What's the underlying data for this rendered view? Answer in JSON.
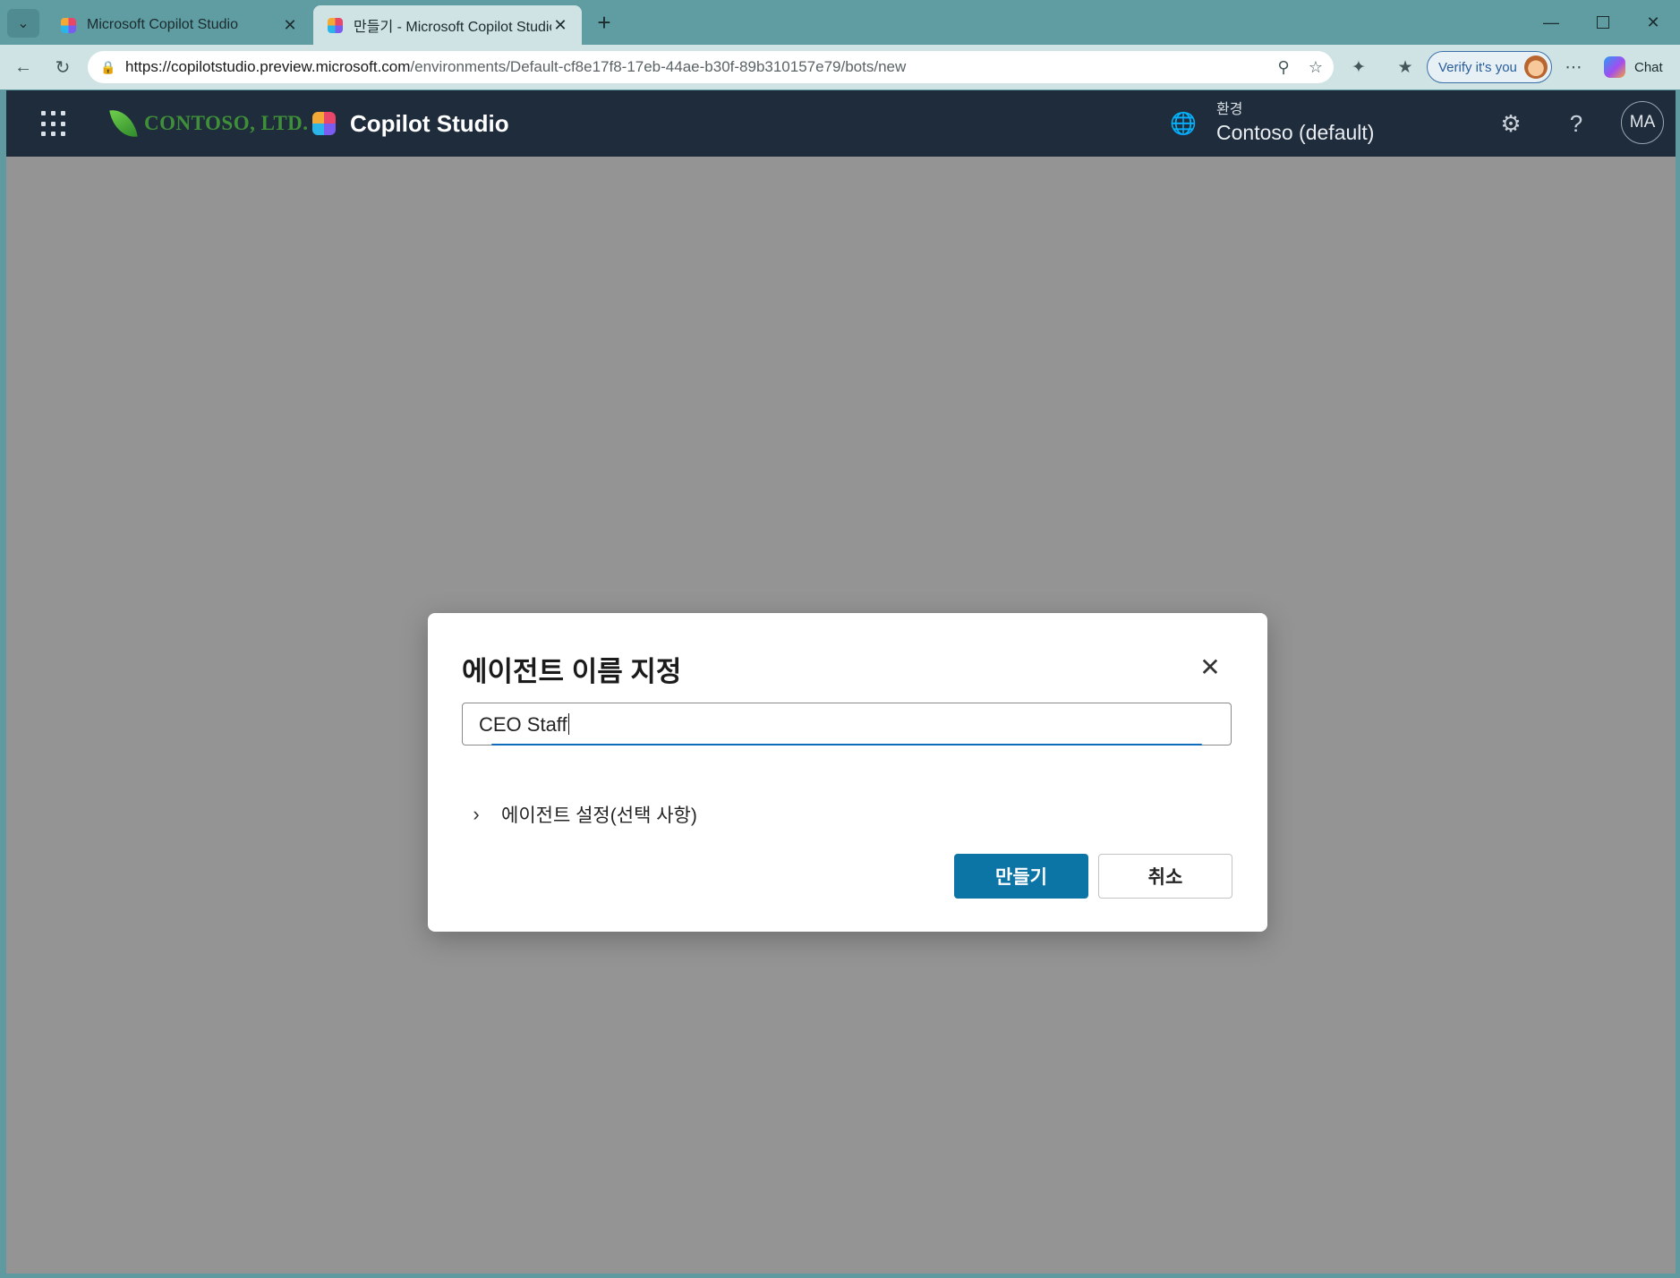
{
  "browser": {
    "tabs": [
      {
        "label": "Microsoft Copilot Studio",
        "active": false
      },
      {
        "label": "만들기 - Microsoft Copilot Studio",
        "active": true
      }
    ],
    "url_host": "https://copilotstudio.preview.microsoft.com",
    "url_path": "/environments/Default-cf8e17f8-17eb-44ae-b30f-89b310157e79/bots/new",
    "verify_label": "Verify it's you",
    "chat_label": "Chat",
    "icons": {
      "tab_menu": "chevron-down-icon",
      "tab_close": "close-icon",
      "new_tab": "plus-icon",
      "back": "back-arrow-icon",
      "refresh": "refresh-icon",
      "site_info": "lock-icon",
      "zoom": "zoom-icon",
      "favorite": "star-icon",
      "extensions": "puzzle-icon",
      "favorites": "favorites-icon",
      "more": "more-icon"
    }
  },
  "app": {
    "org_brand": "CONTOSO, LTD.",
    "product_name": "Copilot Studio",
    "environment": {
      "caption": "환경",
      "value": "Contoso (default)"
    },
    "avatar_initials": "MA",
    "colors": {
      "header_bg": "#1f2c3b",
      "primary": "#0d74a6",
      "focus": "#0f6cbd"
    }
  },
  "dialog": {
    "title": "에이전트 이름 지정",
    "name_value": "CEO Staff",
    "settings_expander": "에이전트 설정(선택 사항)",
    "create_label": "만들기",
    "cancel_label": "취소"
  }
}
